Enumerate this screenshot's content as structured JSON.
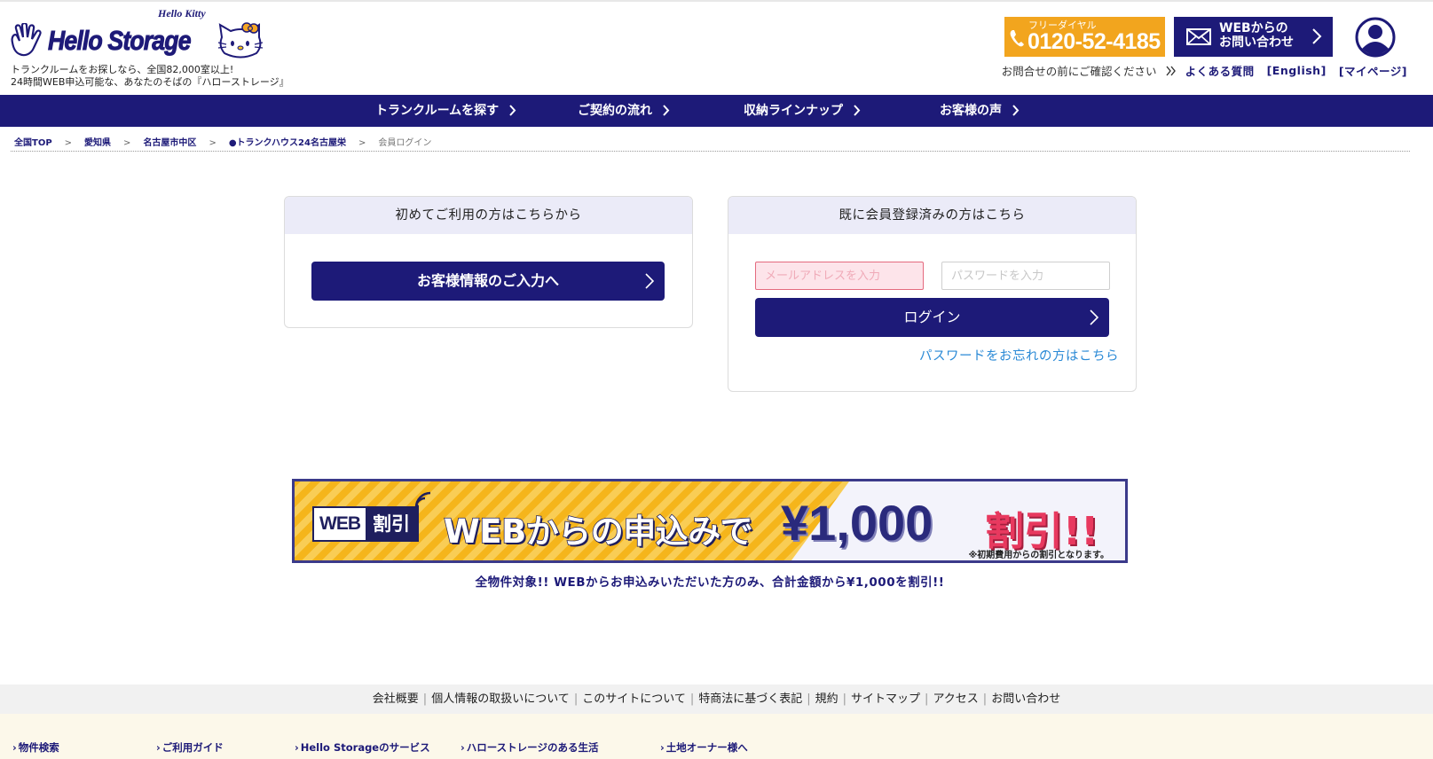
{
  "header": {
    "logo": {
      "text": "Hello Storage",
      "sub_text": "Hello Kitty"
    },
    "tagline_line1": "トランクルームをお探しなら、全国82,000室以上!",
    "tagline_line2": "24時間WEB申込可能な、あなたのそばの『ハローストレージ』",
    "phone": {
      "label": "フリーダイヤル",
      "number": "0120-52-4185"
    },
    "web_contact": "WEBからの\nお問い合わせ",
    "subnav": {
      "note": "お問合せの前にご確認ください",
      "faq": "よくある質問",
      "english": "[English]",
      "mypage": "[マイページ]"
    }
  },
  "nav": [
    {
      "label": "トランクルームを探す"
    },
    {
      "label": "ご契約の流れ"
    },
    {
      "label": "収納ラインナップ"
    },
    {
      "label": "お客様の声"
    }
  ],
  "breadcrumb": [
    "全国TOP",
    "愛知県",
    "名古屋市中区",
    "●トランクハウス24名古屋栄",
    "会員ログイン"
  ],
  "new_user": {
    "heading": "初めてご利用の方はこちらから",
    "button": "お客様情報のご入力へ"
  },
  "member": {
    "heading": "既に会員登録済みの方はこちら",
    "email_placeholder": "メールアドレスを入力",
    "password_placeholder": "パスワードを入力",
    "login_button": "ログイン",
    "forgot_link": "パスワードをお忘れの方はこちら"
  },
  "banner": {
    "badge_web": "WEB",
    "badge_discount": "割引",
    "headline": "WEBからの申込みで",
    "amount": "¥1,000",
    "discount": "割引!!",
    "note": "※初期費用からの割引となります。",
    "caption": "全物件対象!! WEBからお申込みいただいた方のみ、合計金額から¥1,000を割引!!"
  },
  "footer": {
    "links": [
      "会社概要",
      "個人情報の取扱いについて",
      "このサイトについて",
      "特商法に基づく表記",
      "規約",
      "サイトマップ",
      "アクセス",
      "お問い合わせ"
    ],
    "sitemap": [
      "物件検索",
      "ご利用ガイド",
      "Hello Storageのサービス",
      "ハローストレージのある生活",
      "土地オーナー様へ"
    ]
  },
  "colors": {
    "brand_navy": "#1d1a78",
    "phone_orange": "#f2a51e",
    "link_blue": "#2b8ad6",
    "error_pink": "#fde4ea"
  },
  "icons": [
    "hand-logo-icon",
    "hello-kitty-icon",
    "phone-icon",
    "mail-icon",
    "user-icon",
    "chevron-right-icon",
    "wifi-icon"
  ]
}
